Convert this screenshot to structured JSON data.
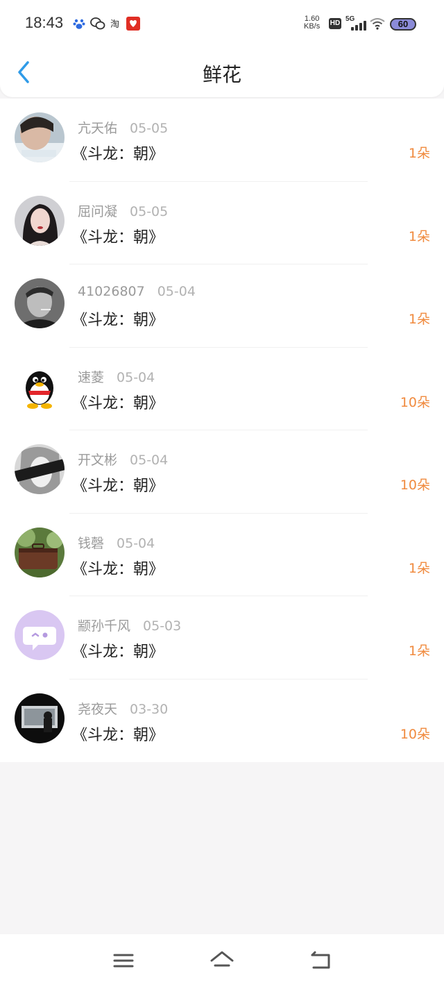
{
  "status_bar": {
    "time": "18:43",
    "net_speed_value": "1.60",
    "net_speed_unit": "KB/s",
    "hd_label": "HD",
    "network_label": "5G",
    "battery": "60",
    "icons": [
      "baidu-paw-icon",
      "wechat-icon",
      "taobao-icon",
      "pinduoduo-icon"
    ]
  },
  "header": {
    "title": "鲜花"
  },
  "colors": {
    "amount": "#f08a3e",
    "name": "#9a9a9a",
    "title": "#222222",
    "back_arrow": "#2f9be8",
    "battery_fill": "#8b8bd8"
  },
  "items": [
    {
      "name": "亢天佑",
      "date": "05-05",
      "book": "《斗龙：朝》",
      "amount": "1朵",
      "avatar": "photo-boy"
    },
    {
      "name": "屈问凝",
      "date": "05-05",
      "book": "《斗龙：朝》",
      "amount": "1朵",
      "avatar": "photo-girl"
    },
    {
      "name": "41026807",
      "date": "05-04",
      "book": "《斗龙：朝》",
      "amount": "1朵",
      "avatar": "photo-smoker"
    },
    {
      "name": "速菱",
      "date": "05-04",
      "book": "《斗龙：朝》",
      "amount": "10朵",
      "avatar": "qq-penguin"
    },
    {
      "name": "开文彬",
      "date": "05-04",
      "book": "《斗龙：朝》",
      "amount": "10朵",
      "avatar": "photo-blindfold"
    },
    {
      "name": "钱磬",
      "date": "05-04",
      "book": "《斗龙：朝》",
      "amount": "1朵",
      "avatar": "photo-suitcase"
    },
    {
      "name": "颛孙千风",
      "date": "05-03",
      "book": "《斗龙：朝》",
      "amount": "1朵",
      "avatar": "default-chat"
    },
    {
      "name": "尧夜天",
      "date": "03-30",
      "book": "《斗龙：朝》",
      "amount": "10朵",
      "avatar": "photo-dark"
    }
  ],
  "navbar": {
    "icons": [
      "menu-icon",
      "home-icon",
      "back-icon"
    ]
  }
}
